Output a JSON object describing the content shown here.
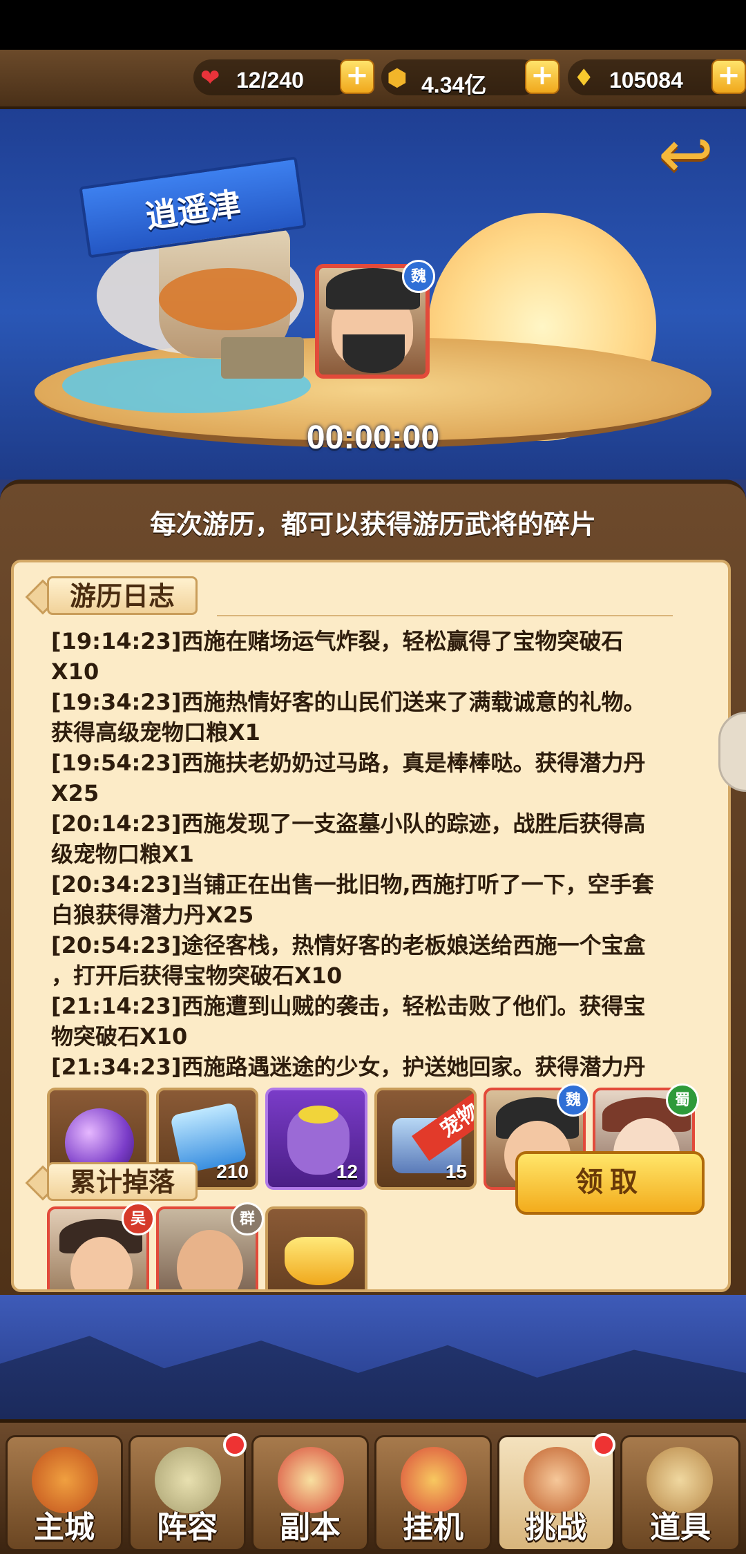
{
  "resources": {
    "stamina": "12/240",
    "gold": "4.34亿",
    "ingots": "105084",
    "plus": "+"
  },
  "scene": {
    "location": "逍遥津",
    "timer": "00:00:00",
    "hero_faction": "魏"
  },
  "panel": {
    "header": "每次游历，都可以获得游历武将的碎片",
    "log_title": "游历日志",
    "log": [
      "[19:14:23]西施在赌场运气炸裂，轻松赢得了宝物突破石",
      "X10",
      "[19:34:23]西施热情好客的山民们送来了满载诚意的礼物。",
      "获得高级宠物口粮X1",
      "[19:54:23]西施扶老奶奶过马路，真是棒棒哒。获得潜力丹",
      "X25",
      "[20:14:23]西施发现了一支盗墓小队的踪迹，战胜后获得高",
      "级宠物口粮X1",
      "[20:34:23]当铺正在出售一批旧物,西施打听了一下，空手套",
      "白狼获得潜力丹X25",
      "[20:54:23]途径客栈，热情好客的老板娘送给西施一个宝盒",
      "，打开后获得宝物突破石X10",
      "[21:14:23]西施遭到山贼的袭击，轻松击败了他们。获得宝",
      "物突破石X10",
      "[21:34:23]西施路遇迷途的少女，护送她回家。获得潜力丹"
    ],
    "drops_title": "累计掉落",
    "drops": [
      {
        "name": "purple-orb",
        "count": ""
      },
      {
        "name": "breakthrough-stone",
        "count": "210"
      },
      {
        "name": "pet-food-bag",
        "count": "12"
      },
      {
        "name": "treasure-chest",
        "count": "15",
        "ribbon": "宠物"
      },
      {
        "name": "hero-wei",
        "count": "",
        "faction": "魏"
      },
      {
        "name": "hero-shu",
        "count": "",
        "faction": "蜀"
      }
    ],
    "drops_row2": [
      {
        "name": "hero-wu",
        "faction": "吴"
      },
      {
        "name": "hero-qun",
        "faction": "群"
      },
      {
        "name": "gold-ingot",
        "faction": ""
      }
    ],
    "claim_label": "领取"
  },
  "nav": [
    {
      "label": "主城",
      "badge": false
    },
    {
      "label": "阵容",
      "badge": true
    },
    {
      "label": "副本",
      "badge": false
    },
    {
      "label": "挂机",
      "badge": false
    },
    {
      "label": "挑战",
      "badge": true,
      "active": true
    },
    {
      "label": "道具",
      "badge": false
    }
  ],
  "colors": {
    "wei": "#2f6fd6",
    "shu": "#2e9a3a",
    "wu": "#d63a2a",
    "qun": "#8a7a6a"
  }
}
